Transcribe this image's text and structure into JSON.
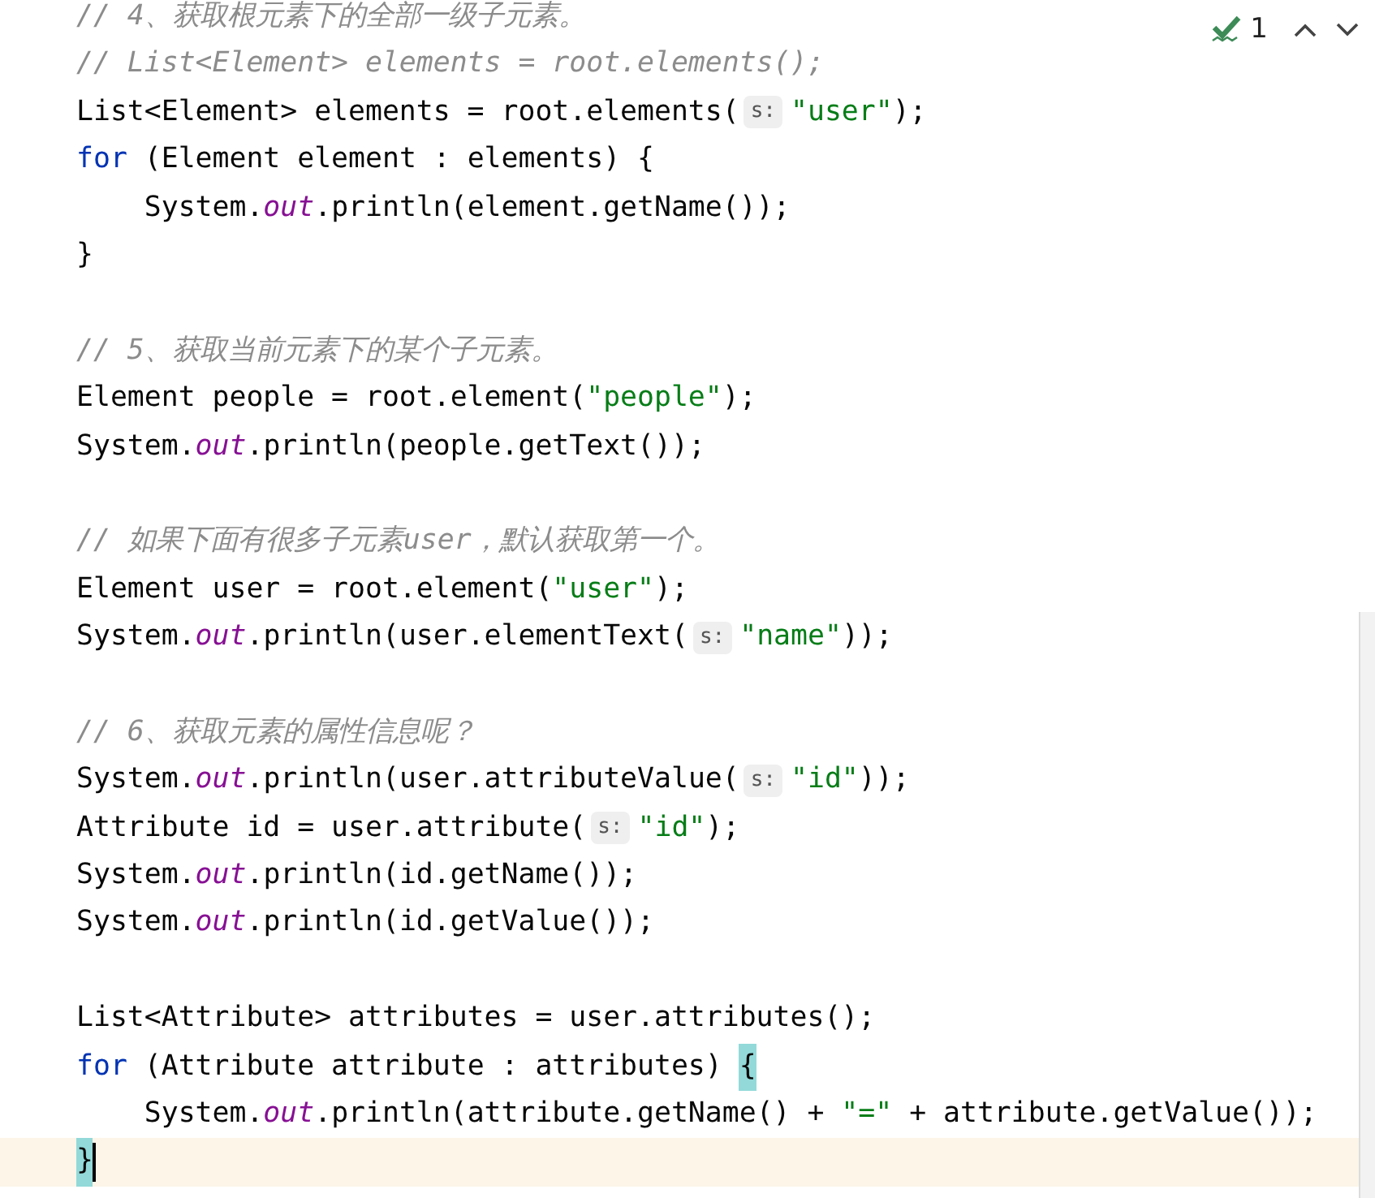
{
  "inspection": {
    "count": "1"
  },
  "lines": [
    {
      "current": false,
      "tokens": [
        {
          "kind": "comment",
          "text": "// 4、获取根元素下的全部一级子元素。"
        }
      ]
    },
    {
      "current": false,
      "tokens": [
        {
          "kind": "comment",
          "text": "// List<Element> elements = root.elements();"
        }
      ]
    },
    {
      "current": false,
      "tokens": [
        {
          "kind": "plain",
          "text": "List<Element> elements = root.elements("
        },
        {
          "kind": "hint",
          "text": "s:"
        },
        {
          "kind": "string",
          "text": "\"user\""
        },
        {
          "kind": "plain",
          "text": ");"
        }
      ]
    },
    {
      "current": false,
      "tokens": [
        {
          "kind": "keyword",
          "text": "for"
        },
        {
          "kind": "plain",
          "text": " (Element element : elements) {"
        }
      ]
    },
    {
      "current": false,
      "tokens": [
        {
          "kind": "plain",
          "text": "    System."
        },
        {
          "kind": "field",
          "text": "out"
        },
        {
          "kind": "plain",
          "text": ".println(element.getName());"
        }
      ]
    },
    {
      "current": false,
      "tokens": [
        {
          "kind": "plain",
          "text": "}"
        }
      ]
    },
    {
      "current": false
    },
    {
      "current": false,
      "tokens": [
        {
          "kind": "comment",
          "text": "// 5、获取当前元素下的某个子元素。"
        }
      ]
    },
    {
      "current": false,
      "tokens": [
        {
          "kind": "plain",
          "text": "Element people = root.element("
        },
        {
          "kind": "string",
          "text": "\"people\""
        },
        {
          "kind": "plain",
          "text": ");"
        }
      ]
    },
    {
      "current": false,
      "tokens": [
        {
          "kind": "plain",
          "text": "System."
        },
        {
          "kind": "field",
          "text": "out"
        },
        {
          "kind": "plain",
          "text": ".println(people.getText());"
        }
      ]
    },
    {
      "current": false
    },
    {
      "current": false,
      "tokens": [
        {
          "kind": "comment",
          "text": "// 如果下面有很多子元素user，默认获取第一个。"
        }
      ]
    },
    {
      "current": false,
      "tokens": [
        {
          "kind": "plain",
          "text": "Element user = root.element("
        },
        {
          "kind": "string",
          "text": "\"user\""
        },
        {
          "kind": "plain",
          "text": ");"
        }
      ]
    },
    {
      "current": false,
      "tokens": [
        {
          "kind": "plain",
          "text": "System."
        },
        {
          "kind": "field",
          "text": "out"
        },
        {
          "kind": "plain",
          "text": ".println(user.elementText("
        },
        {
          "kind": "hint",
          "text": "s:"
        },
        {
          "kind": "string",
          "text": "\"name\""
        },
        {
          "kind": "plain",
          "text": "));"
        }
      ]
    },
    {
      "current": false
    },
    {
      "current": false,
      "tokens": [
        {
          "kind": "comment",
          "text": "// 6、获取元素的属性信息呢？"
        }
      ]
    },
    {
      "current": false,
      "tokens": [
        {
          "kind": "plain",
          "text": "System."
        },
        {
          "kind": "field",
          "text": "out"
        },
        {
          "kind": "plain",
          "text": ".println(user.attributeValue("
        },
        {
          "kind": "hint",
          "text": "s:"
        },
        {
          "kind": "string",
          "text": "\"id\""
        },
        {
          "kind": "plain",
          "text": "));"
        }
      ]
    },
    {
      "current": false,
      "tokens": [
        {
          "kind": "plain",
          "text": "Attribute id = user.attribute("
        },
        {
          "kind": "hint",
          "text": "s:"
        },
        {
          "kind": "string",
          "text": "\"id\""
        },
        {
          "kind": "plain",
          "text": ");"
        }
      ]
    },
    {
      "current": false,
      "tokens": [
        {
          "kind": "plain",
          "text": "System."
        },
        {
          "kind": "field",
          "text": "out"
        },
        {
          "kind": "plain",
          "text": ".println(id.getName());"
        }
      ]
    },
    {
      "current": false,
      "tokens": [
        {
          "kind": "plain",
          "text": "System."
        },
        {
          "kind": "field",
          "text": "out"
        },
        {
          "kind": "plain",
          "text": ".println(id.getValue());"
        }
      ]
    },
    {
      "current": false
    },
    {
      "current": false,
      "tokens": [
        {
          "kind": "plain",
          "text": "List<Attribute> attributes = user.attributes();"
        }
      ]
    },
    {
      "current": false,
      "tokens": [
        {
          "kind": "keyword",
          "text": "for"
        },
        {
          "kind": "plain",
          "text": " (Attribute attribute : attributes) "
        },
        {
          "kind": "brace",
          "text": "{"
        }
      ]
    },
    {
      "current": false,
      "tokens": [
        {
          "kind": "plain",
          "text": "    System."
        },
        {
          "kind": "field",
          "text": "out"
        },
        {
          "kind": "plain",
          "text": ".println(attribute.getName() + "
        },
        {
          "kind": "string",
          "text": "\"=\""
        },
        {
          "kind": "plain",
          "text": " + attribute.getValue());"
        }
      ]
    },
    {
      "current": true,
      "tokens": [
        {
          "kind": "brace",
          "text": "}"
        }
      ]
    }
  ]
}
